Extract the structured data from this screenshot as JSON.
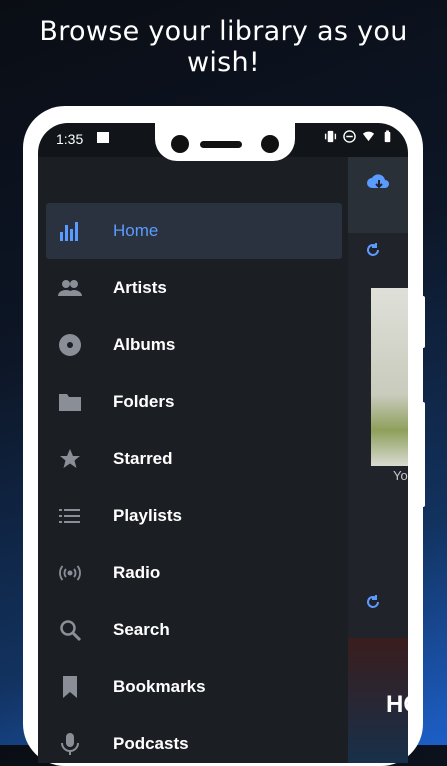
{
  "headline": "Browse your library as you wish!",
  "status": {
    "time": "1:35"
  },
  "menu": [
    {
      "label": "Home",
      "icon": "bar-chart-icon",
      "active": true
    },
    {
      "label": "Artists",
      "icon": "people-icon"
    },
    {
      "label": "Albums",
      "icon": "disc-icon"
    },
    {
      "label": "Folders",
      "icon": "folder-icon"
    },
    {
      "label": "Starred",
      "icon": "star-icon"
    },
    {
      "label": "Playlists",
      "icon": "list-icon"
    },
    {
      "label": "Radio",
      "icon": "radio-waves-icon"
    },
    {
      "label": "Search",
      "icon": "search-icon"
    },
    {
      "label": "Bookmarks",
      "icon": "bookmark-icon"
    },
    {
      "label": "Podcasts",
      "icon": "mic-icon"
    }
  ],
  "background": {
    "caption_fragment": "Yo",
    "cover_fragment": "HO"
  },
  "colors": {
    "accent": "#5b9bff",
    "drawer": "#1b1e23",
    "icon_gray": "#8a8f97"
  }
}
